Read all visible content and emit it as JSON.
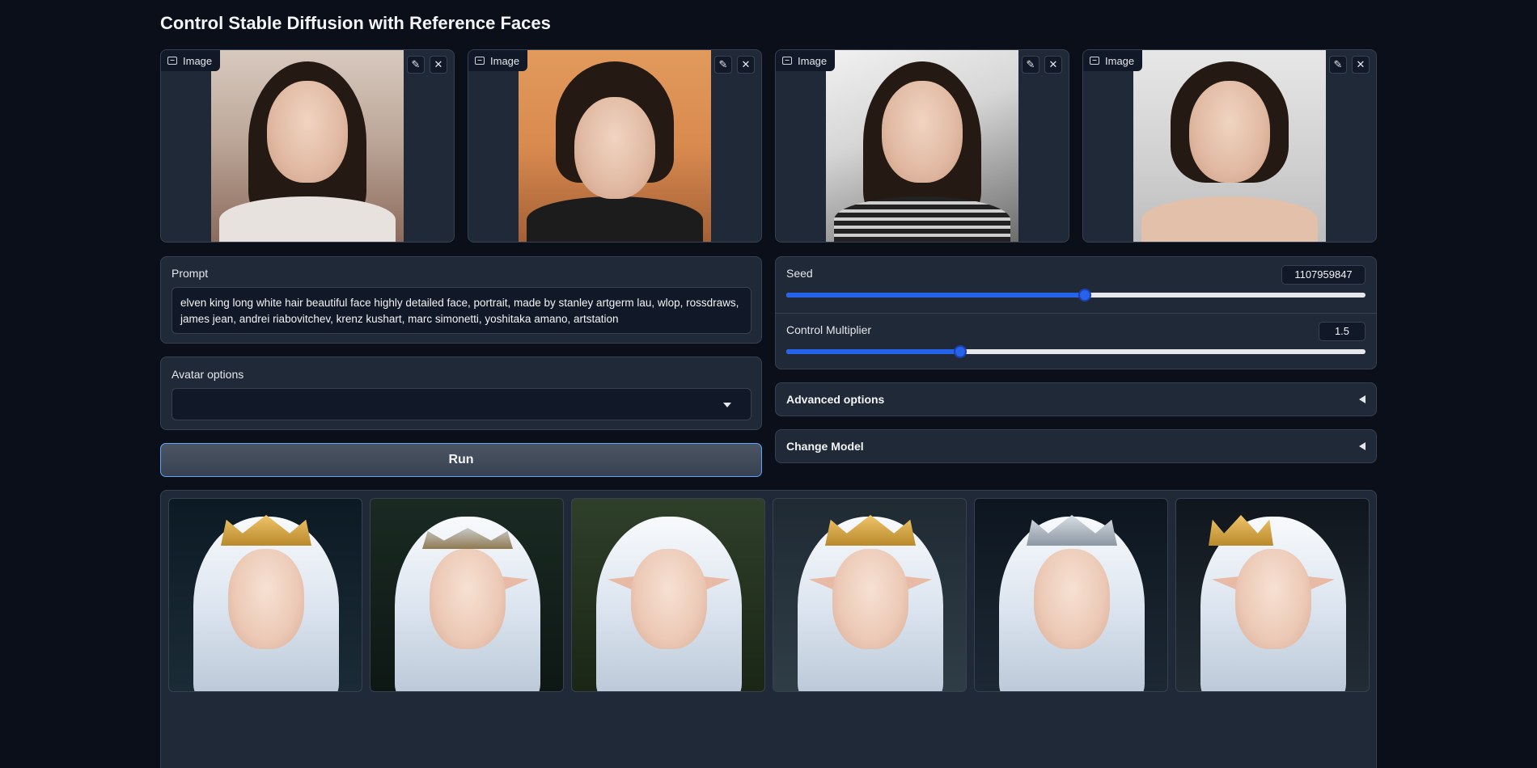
{
  "app": {
    "title": "Control Stable Diffusion with Reference Faces"
  },
  "reference_images": [
    {
      "label": "Image"
    },
    {
      "label": "Image"
    },
    {
      "label": "Image"
    },
    {
      "label": "Image"
    }
  ],
  "prompt": {
    "label": "Prompt",
    "value": "elven king long white hair beautiful face highly detailed face, portrait, made by stanley artgerm lau, wlop, rossdraws, james jean, andrei riabovitchev, krenz kushart, marc simonetti, yoshitaka amano, artstation"
  },
  "avatar_options": {
    "label": "Avatar options",
    "value": ""
  },
  "run_button": {
    "label": "Run"
  },
  "seed": {
    "label": "Seed",
    "value": "1107959847",
    "fraction": 0.516
  },
  "control_multiplier": {
    "label": "Control Multiplier",
    "value": "1.5",
    "fraction": 0.3
  },
  "accordions": {
    "advanced": {
      "label": "Advanced options"
    },
    "change_model": {
      "label": "Change Model"
    }
  },
  "gallery": {
    "count": 6,
    "icons": [
      "image-icon",
      "edit-icon",
      "close-icon",
      "chevron-down-icon",
      "collapse-arrow-icon"
    ]
  },
  "colors": {
    "background": "#0b0f19",
    "panel": "#1f2937",
    "accent": "#2563eb",
    "run_border": "#60a5fa"
  }
}
